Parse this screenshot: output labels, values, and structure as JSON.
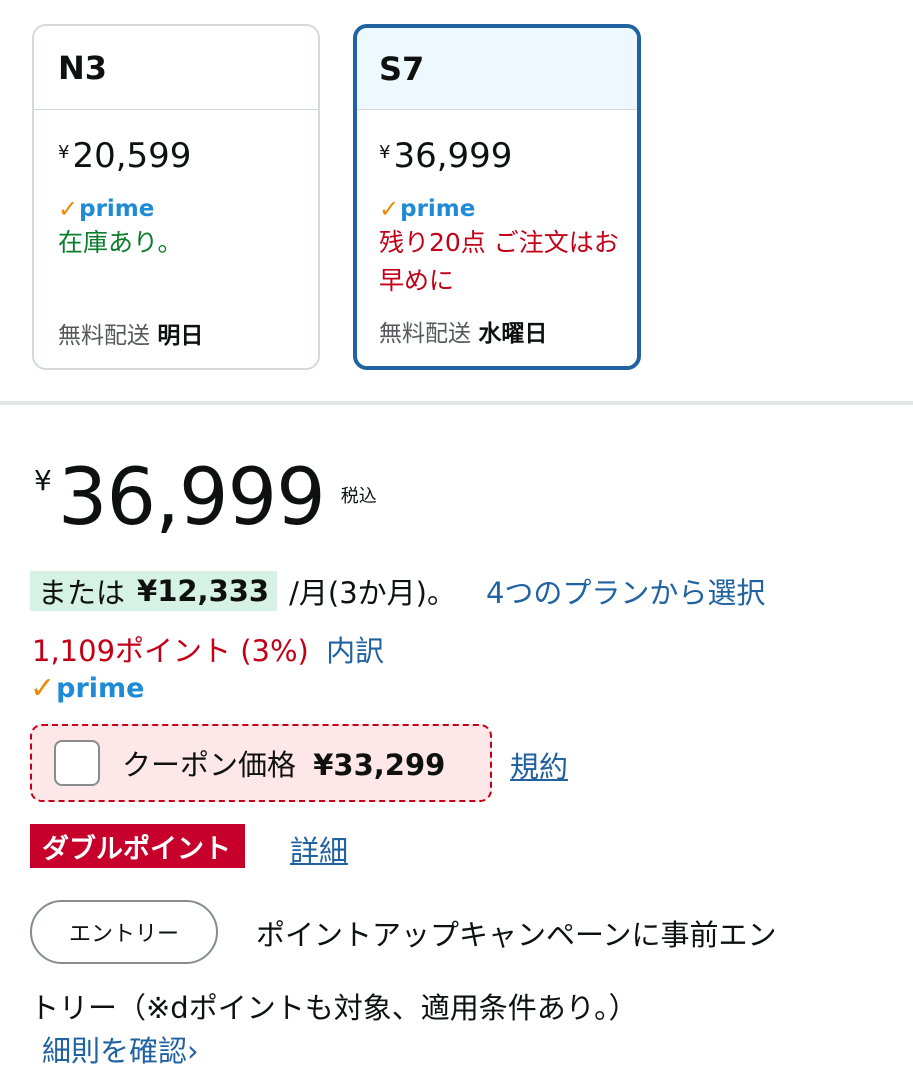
{
  "variants": [
    {
      "name": "N3",
      "price_symbol": "¥",
      "price": "20,599",
      "prime_label": "prime",
      "availability": "在庫あり。",
      "delivery_prefix": "無料配送",
      "delivery_day": "明日",
      "selected": false
    },
    {
      "name": "S7",
      "price_symbol": "¥",
      "price": "36,999",
      "prime_label": "prime",
      "availability": "残り20点 ご注文はお早めに",
      "delivery_prefix": "無料配送",
      "delivery_day": "水曜日",
      "selected": true
    }
  ],
  "main_price": {
    "symbol": "¥",
    "amount": "36,999",
    "tax_label": "税込"
  },
  "installment": {
    "prefix": "または",
    "amount": "¥12,333",
    "per": "/月(3か月)。",
    "link": "4つのプランから選択"
  },
  "points": {
    "text": "1,109ポイント (3%)",
    "link": "内訳"
  },
  "prime_label": "prime",
  "coupon": {
    "label": "クーポン価格",
    "price": "¥33,299",
    "checked": false,
    "terms_link": "規約"
  },
  "double_point": {
    "badge": "ダブルポイント",
    "link": "詳細"
  },
  "campaign": {
    "entry_button": "エントリー",
    "text_line1": "ポイントアップキャンペーンに事前エン",
    "text_line2": "トリー（※dポイントも対象、適用条件あり。）",
    "details_link": "細則を確認›"
  },
  "colors": {
    "selected_border": "#2162a1",
    "link": "#2162a1",
    "in_stock": "#0a7d2b",
    "alert": "#c40018",
    "prime_check": "#f08804",
    "prime_text": "#1f8bd6"
  }
}
